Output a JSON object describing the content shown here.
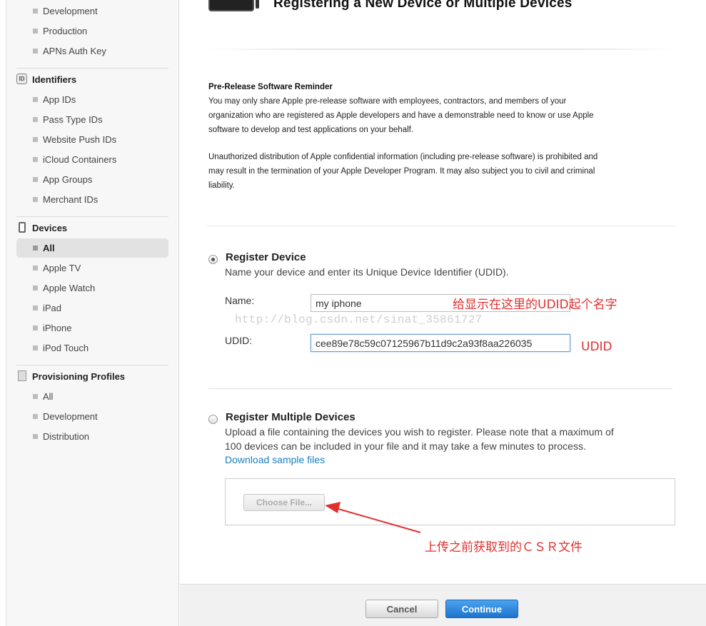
{
  "sidebar": {
    "certificates_items": [
      "Development",
      "Production",
      "APNs Auth Key"
    ],
    "identifiers": {
      "header": "Identifiers",
      "icon_text": "ID",
      "items": [
        "App IDs",
        "Pass Type IDs",
        "Website Push IDs",
        "iCloud Containers",
        "App Groups",
        "Merchant IDs"
      ]
    },
    "devices": {
      "header": "Devices",
      "items": [
        "All",
        "Apple TV",
        "Apple Watch",
        "iPad",
        "iPhone",
        "iPod Touch"
      ],
      "selected": "All"
    },
    "profiles": {
      "header": "Provisioning Profiles",
      "items": [
        "All",
        "Development",
        "Distribution"
      ]
    }
  },
  "main": {
    "title": "Registering a New Device or Multiple Devices",
    "reminder": {
      "title": "Pre-Release Software Reminder",
      "p1_l1": "You may only share Apple pre-release software with employees, contractors, and members of your",
      "p1_l2": "organization who are registered as Apple developers and have a demonstrable need to know or use Apple",
      "p1_l3": "software to develop and test applications on your behalf.",
      "p2_l1": "Unauthorized distribution of Apple confidential information (including pre-release software) is prohibited and",
      "p2_l2": "may result in the termination of your Apple Developer Program. It may also subject you to civil and criminal",
      "p2_l3": "liability."
    },
    "register_device": {
      "title": "Register Device",
      "desc": "Name your device and enter its Unique Device Identifier (UDID).",
      "name_label": "Name:",
      "name_value": "my iphone",
      "udid_label": "UDID:",
      "udid_value": "cee89e78c59c07125967b11d9c2a93f8aa226035"
    },
    "register_multiple": {
      "title": "Register Multiple Devices",
      "desc_l1": "Upload a file containing the devices you wish to register. Please note that a maximum of",
      "desc_l2": "100 devices can be included in your file and it may take a few minutes to process.",
      "link": "Download sample files",
      "choose_file": "Choose File..."
    },
    "footer": {
      "cancel": "Cancel",
      "continue": "Continue"
    }
  },
  "annotations": {
    "name_note": "给显示在这里的UDID起个名字",
    "udid_note": "UDID",
    "csr_note": "上传之前获取到的ＣＳＲ文件",
    "watermark": "http://blog.csdn.net/sinat_35861727"
  },
  "colors": {
    "accent": "#1b7ec2",
    "annotation": "#e0302e",
    "continue_button": "#1e74cc"
  }
}
